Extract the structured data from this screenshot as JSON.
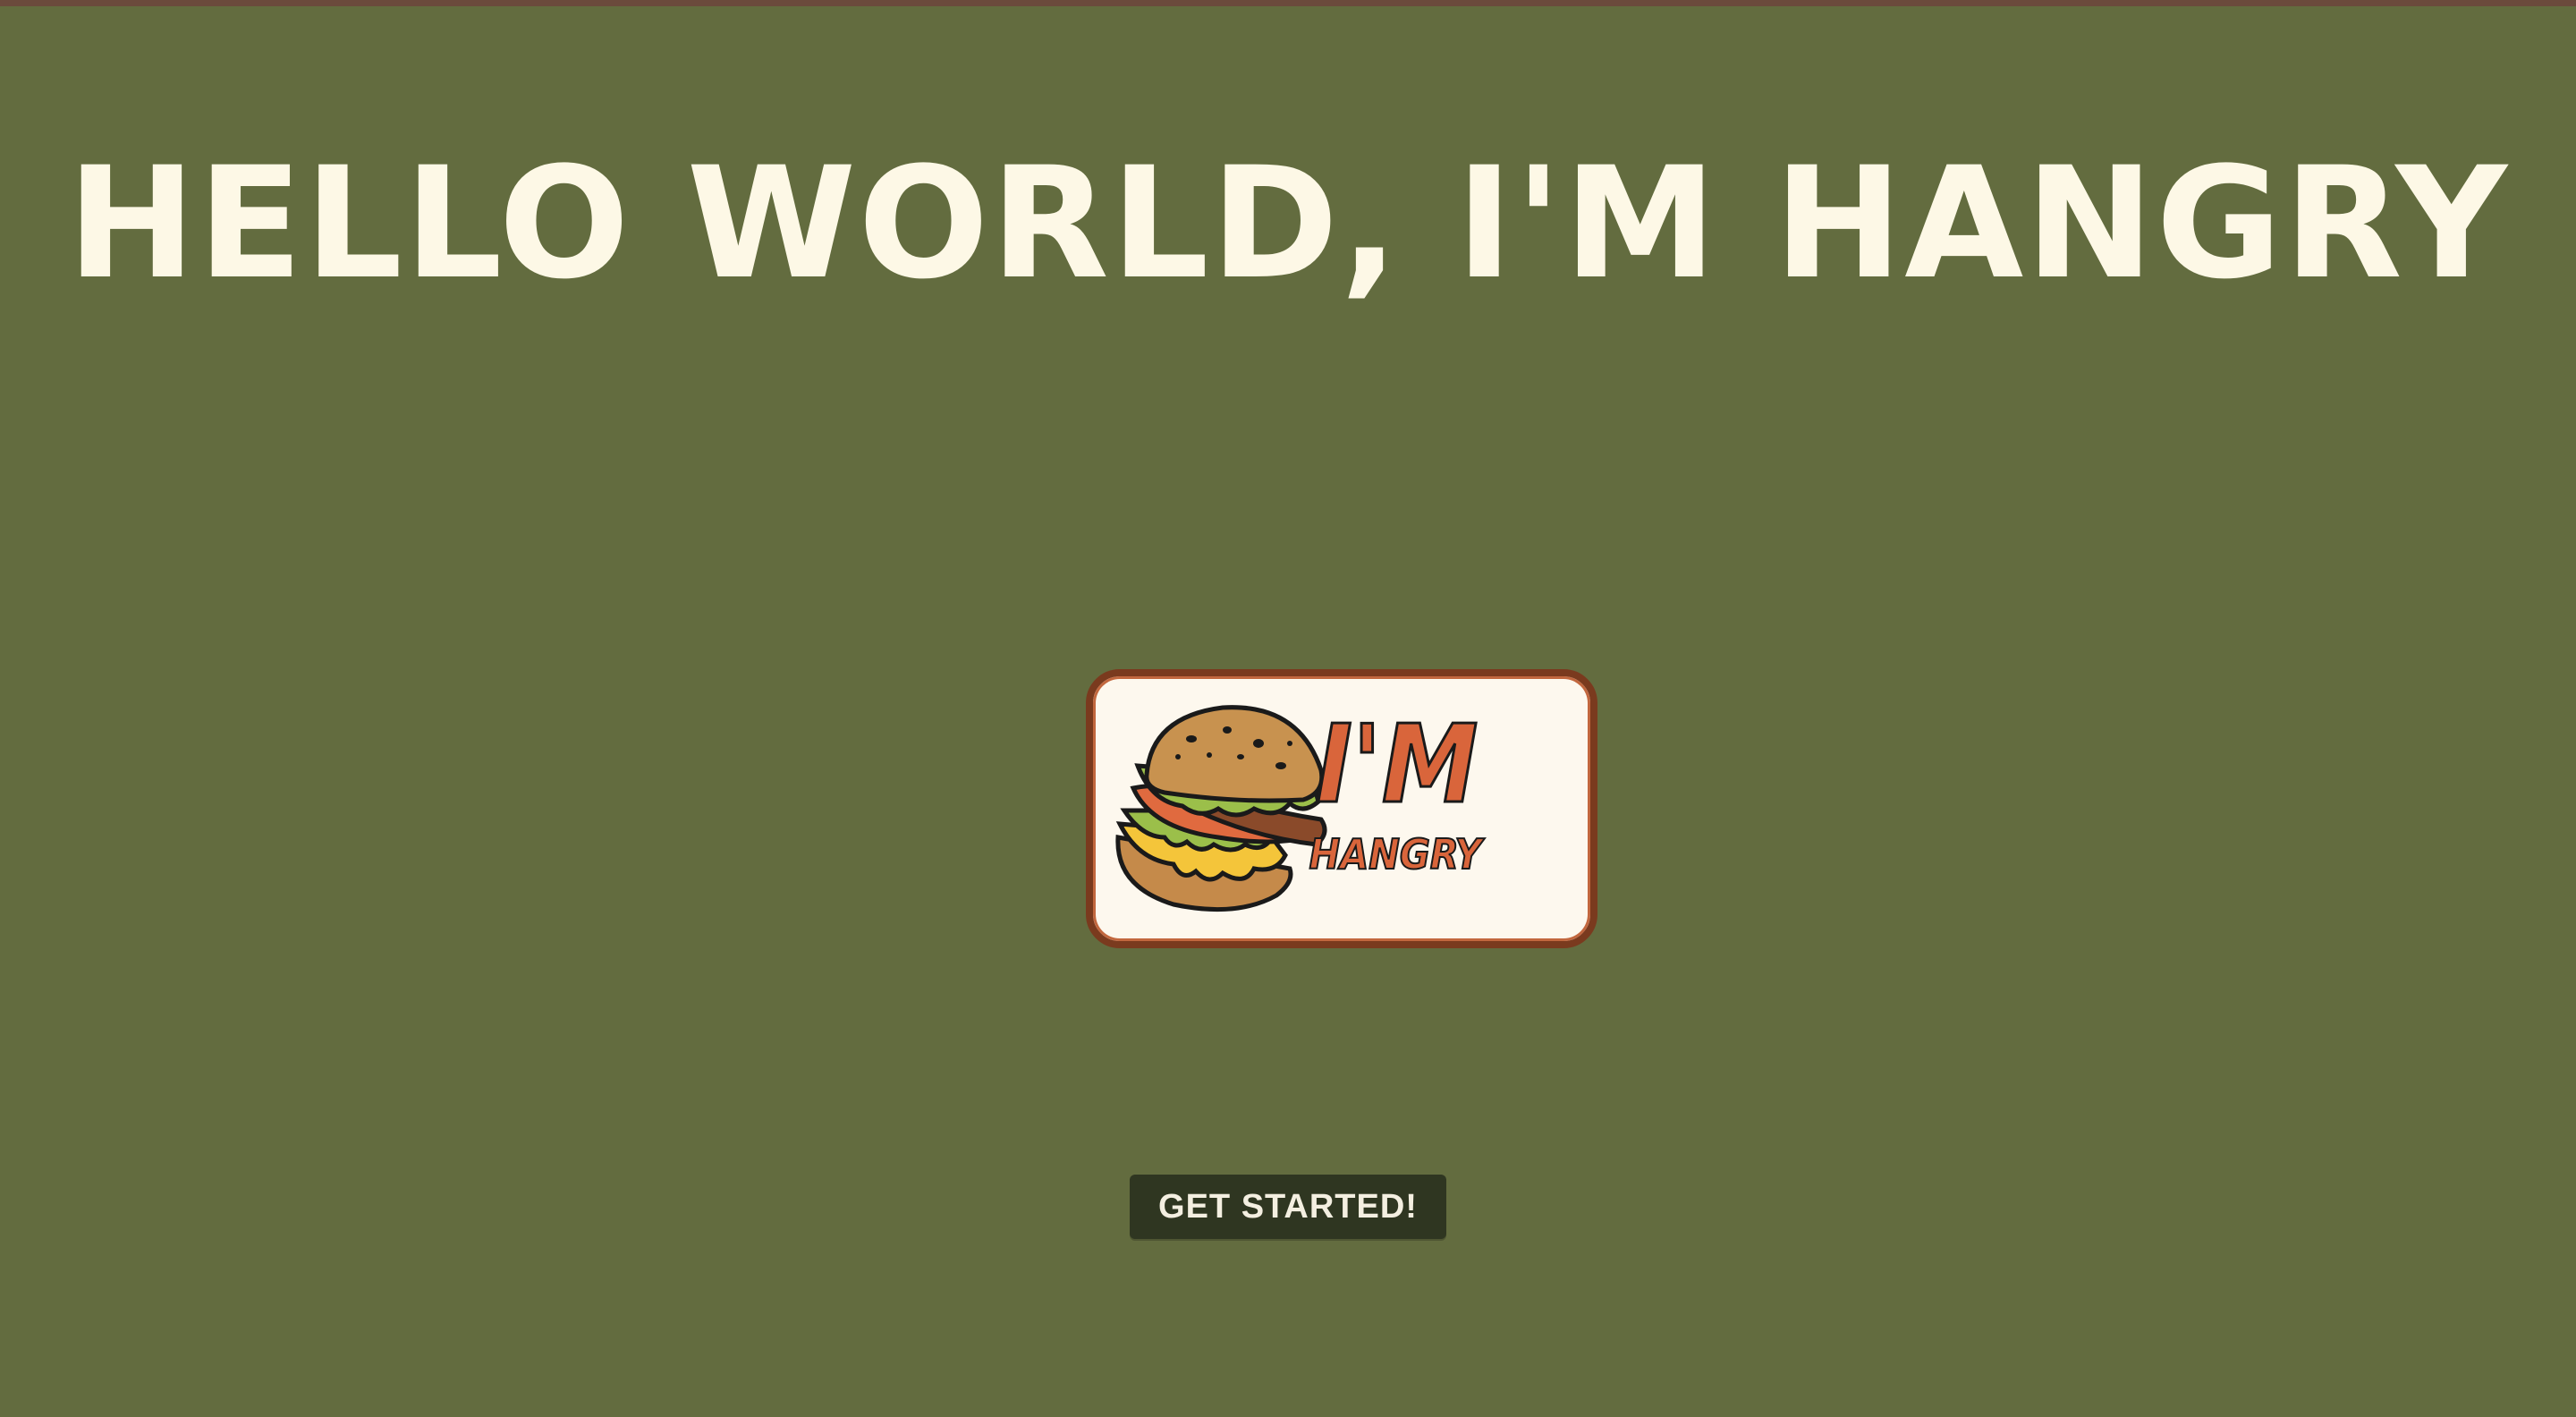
{
  "hero": {
    "title": "HELLO WORLD, I'M HANGRY"
  },
  "logo": {
    "line1": "I'M",
    "line2": "HANGRY",
    "icon": "burger-icon"
  },
  "cta": {
    "label": "GET STARTED!"
  },
  "colors": {
    "background": "#636c3f",
    "title": "#fdf8e6",
    "button": "#2f3621",
    "logo_border": "#7a3a1e",
    "logo_accent": "#d9653b"
  }
}
